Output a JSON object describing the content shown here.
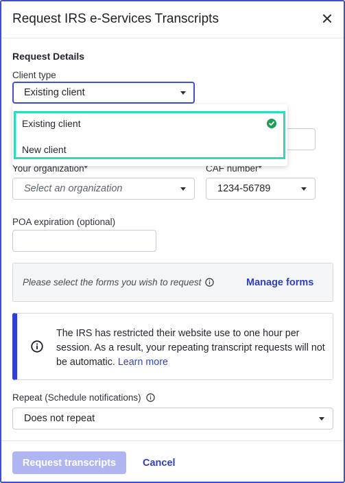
{
  "header": {
    "title": "Request IRS e-Services Transcripts"
  },
  "details": {
    "section_title": "Request Details",
    "client_type_label": "Client type",
    "client_type_value": "Existing client",
    "client_type_options": [
      {
        "label": "Existing client",
        "selected": true
      },
      {
        "label": "New client",
        "selected": false
      }
    ],
    "organization_label": "Your organization*",
    "organization_placeholder": "Select an organization",
    "caf_label": "CAF number*",
    "caf_value": "1234-56789",
    "poa_label": "POA expiration (optional)",
    "poa_value": ""
  },
  "forms": {
    "prompt": "Please select the forms you wish to request",
    "manage_label": "Manage forms"
  },
  "notice": {
    "text": "The IRS has restricted their website use to one hour per session. As a result, your repeating transcript requests will not be automatic.",
    "link_label": "Learn more"
  },
  "repeat": {
    "label": "Repeat (Schedule notifications)",
    "value": "Does not repeat"
  },
  "footer": {
    "primary_label": "Request transcripts",
    "cancel_label": "Cancel"
  },
  "colors": {
    "accent": "#3d4fd6",
    "highlight": "#2bdcbc",
    "success": "#1d9d55",
    "primary_disabled": "#aeb5f1"
  }
}
